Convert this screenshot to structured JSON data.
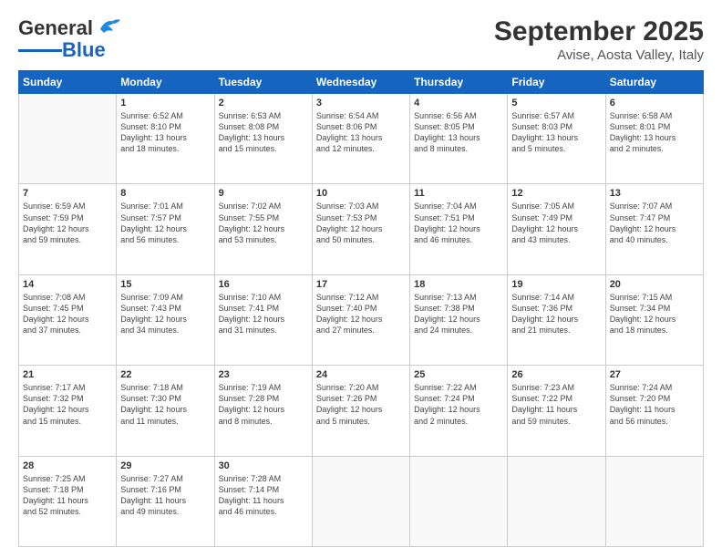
{
  "logo": {
    "general": "General",
    "blue": "Blue"
  },
  "header": {
    "title": "September 2025",
    "subtitle": "Avise, Aosta Valley, Italy"
  },
  "weekdays": [
    "Sunday",
    "Monday",
    "Tuesday",
    "Wednesday",
    "Thursday",
    "Friday",
    "Saturday"
  ],
  "weeks": [
    [
      {
        "day": "",
        "content": ""
      },
      {
        "day": "1",
        "content": "Sunrise: 6:52 AM\nSunset: 8:10 PM\nDaylight: 13 hours\nand 18 minutes."
      },
      {
        "day": "2",
        "content": "Sunrise: 6:53 AM\nSunset: 8:08 PM\nDaylight: 13 hours\nand 15 minutes."
      },
      {
        "day": "3",
        "content": "Sunrise: 6:54 AM\nSunset: 8:06 PM\nDaylight: 13 hours\nand 12 minutes."
      },
      {
        "day": "4",
        "content": "Sunrise: 6:56 AM\nSunset: 8:05 PM\nDaylight: 13 hours\nand 8 minutes."
      },
      {
        "day": "5",
        "content": "Sunrise: 6:57 AM\nSunset: 8:03 PM\nDaylight: 13 hours\nand 5 minutes."
      },
      {
        "day": "6",
        "content": "Sunrise: 6:58 AM\nSunset: 8:01 PM\nDaylight: 13 hours\nand 2 minutes."
      }
    ],
    [
      {
        "day": "7",
        "content": "Sunrise: 6:59 AM\nSunset: 7:59 PM\nDaylight: 12 hours\nand 59 minutes."
      },
      {
        "day": "8",
        "content": "Sunrise: 7:01 AM\nSunset: 7:57 PM\nDaylight: 12 hours\nand 56 minutes."
      },
      {
        "day": "9",
        "content": "Sunrise: 7:02 AM\nSunset: 7:55 PM\nDaylight: 12 hours\nand 53 minutes."
      },
      {
        "day": "10",
        "content": "Sunrise: 7:03 AM\nSunset: 7:53 PM\nDaylight: 12 hours\nand 50 minutes."
      },
      {
        "day": "11",
        "content": "Sunrise: 7:04 AM\nSunset: 7:51 PM\nDaylight: 12 hours\nand 46 minutes."
      },
      {
        "day": "12",
        "content": "Sunrise: 7:05 AM\nSunset: 7:49 PM\nDaylight: 12 hours\nand 43 minutes."
      },
      {
        "day": "13",
        "content": "Sunrise: 7:07 AM\nSunset: 7:47 PM\nDaylight: 12 hours\nand 40 minutes."
      }
    ],
    [
      {
        "day": "14",
        "content": "Sunrise: 7:08 AM\nSunset: 7:45 PM\nDaylight: 12 hours\nand 37 minutes."
      },
      {
        "day": "15",
        "content": "Sunrise: 7:09 AM\nSunset: 7:43 PM\nDaylight: 12 hours\nand 34 minutes."
      },
      {
        "day": "16",
        "content": "Sunrise: 7:10 AM\nSunset: 7:41 PM\nDaylight: 12 hours\nand 31 minutes."
      },
      {
        "day": "17",
        "content": "Sunrise: 7:12 AM\nSunset: 7:40 PM\nDaylight: 12 hours\nand 27 minutes."
      },
      {
        "day": "18",
        "content": "Sunrise: 7:13 AM\nSunset: 7:38 PM\nDaylight: 12 hours\nand 24 minutes."
      },
      {
        "day": "19",
        "content": "Sunrise: 7:14 AM\nSunset: 7:36 PM\nDaylight: 12 hours\nand 21 minutes."
      },
      {
        "day": "20",
        "content": "Sunrise: 7:15 AM\nSunset: 7:34 PM\nDaylight: 12 hours\nand 18 minutes."
      }
    ],
    [
      {
        "day": "21",
        "content": "Sunrise: 7:17 AM\nSunset: 7:32 PM\nDaylight: 12 hours\nand 15 minutes."
      },
      {
        "day": "22",
        "content": "Sunrise: 7:18 AM\nSunset: 7:30 PM\nDaylight: 12 hours\nand 11 minutes."
      },
      {
        "day": "23",
        "content": "Sunrise: 7:19 AM\nSunset: 7:28 PM\nDaylight: 12 hours\nand 8 minutes."
      },
      {
        "day": "24",
        "content": "Sunrise: 7:20 AM\nSunset: 7:26 PM\nDaylight: 12 hours\nand 5 minutes."
      },
      {
        "day": "25",
        "content": "Sunrise: 7:22 AM\nSunset: 7:24 PM\nDaylight: 12 hours\nand 2 minutes."
      },
      {
        "day": "26",
        "content": "Sunrise: 7:23 AM\nSunset: 7:22 PM\nDaylight: 11 hours\nand 59 minutes."
      },
      {
        "day": "27",
        "content": "Sunrise: 7:24 AM\nSunset: 7:20 PM\nDaylight: 11 hours\nand 56 minutes."
      }
    ],
    [
      {
        "day": "28",
        "content": "Sunrise: 7:25 AM\nSunset: 7:18 PM\nDaylight: 11 hours\nand 52 minutes."
      },
      {
        "day": "29",
        "content": "Sunrise: 7:27 AM\nSunset: 7:16 PM\nDaylight: 11 hours\nand 49 minutes."
      },
      {
        "day": "30",
        "content": "Sunrise: 7:28 AM\nSunset: 7:14 PM\nDaylight: 11 hours\nand 46 minutes."
      },
      {
        "day": "",
        "content": ""
      },
      {
        "day": "",
        "content": ""
      },
      {
        "day": "",
        "content": ""
      },
      {
        "day": "",
        "content": ""
      }
    ]
  ]
}
